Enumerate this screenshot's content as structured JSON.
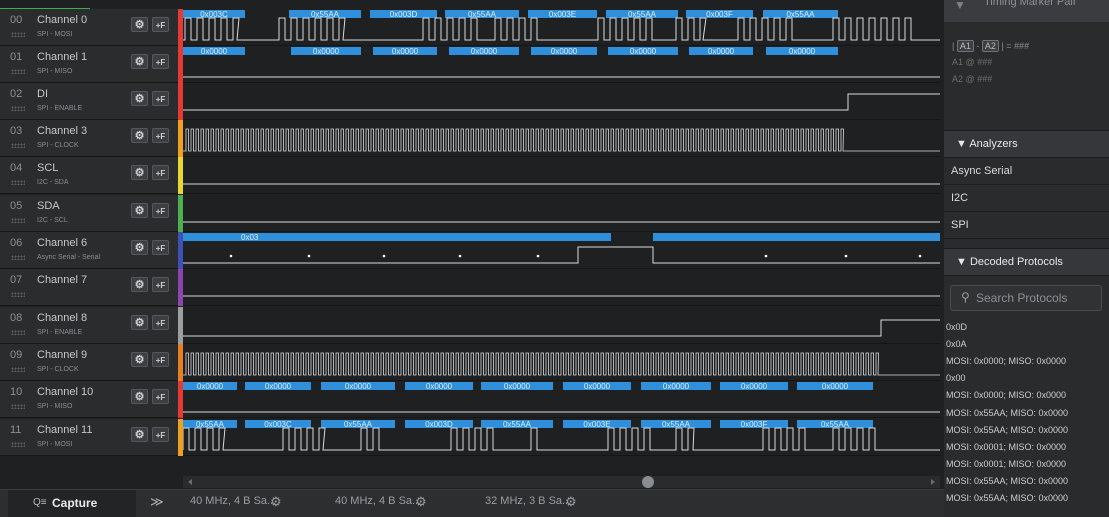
{
  "channels": [
    {
      "num": "00",
      "name": "Channel 0",
      "sub": "SPI - MOSI",
      "color": "#e53935"
    },
    {
      "num": "01",
      "name": "Channel 1",
      "sub": "SPI - MISO",
      "color": "#e53935"
    },
    {
      "num": "02",
      "name": "DI",
      "sub": "SPI - ENABLE",
      "color": "#e53935"
    },
    {
      "num": "03",
      "name": "Channel 3",
      "sub": "SPI - CLOCK",
      "color": "#f0a020"
    },
    {
      "num": "04",
      "name": "SCL",
      "sub": "I2C - SDA",
      "color": "#e8d730"
    },
    {
      "num": "05",
      "name": "SDA",
      "sub": "I2C - SCL",
      "color": "#4caf50"
    },
    {
      "num": "06",
      "name": "Channel 6",
      "sub": "Async Serial - Serial",
      "color": "#3f51b5"
    },
    {
      "num": "07",
      "name": "Channel 7",
      "sub": "",
      "color": "#8e44ad"
    },
    {
      "num": "08",
      "name": "Channel 8",
      "sub": "SPI - ENABLE",
      "color": "#9e9e9e"
    },
    {
      "num": "09",
      "name": "Channel 9",
      "sub": "SPI - CLOCK",
      "color": "#e67e22"
    },
    {
      "num": "10",
      "name": "Channel 10",
      "sub": "SPI - MISO",
      "color": "#e53935"
    },
    {
      "num": "11",
      "name": "Channel 11",
      "sub": "SPI - MOSI",
      "color": "#f0a020"
    }
  ],
  "gear_glyph": "⚙",
  "trigger_glyph": "+F",
  "decode_rows": {
    "ch0": [
      "0x003C",
      "0x55AA",
      "0x003D",
      "0x55AA",
      "0x003E",
      "0x55AA",
      "0x003F",
      "0x55AA"
    ],
    "ch1": [
      "0x0000",
      "0x0000",
      "0x0000",
      "0x0000",
      "0x0000",
      "0x0000",
      "0x0000",
      "0x0000"
    ],
    "ch6": [
      "0x03"
    ],
    "ch10": [
      "0x0000",
      "0x0000",
      "0x0000",
      "0x0000",
      "0x0000",
      "0x0000",
      "0x0000",
      "0x0000",
      "0x0000"
    ],
    "ch11": [
      "0x55AA",
      "0x003C",
      "0x55AA",
      "0x003D",
      "0x55AA",
      "0x003E",
      "0x55AA",
      "0x003F",
      "0x55AA"
    ]
  },
  "timing": {
    "title": "Timing Marker Pair",
    "formula_a1": "A1",
    "formula_a2": "A2",
    "formula_result": "= ###",
    "a1_label": "A1",
    "a1_at": "@",
    "a1_value": "###",
    "a2_label": "A2",
    "a2_at": "@",
    "a2_value": "###"
  },
  "analyzers": {
    "header": "▼ Analyzers",
    "items": [
      "Async Serial",
      "I2C",
      "SPI"
    ]
  },
  "decoded": {
    "header": "▼ Decoded Protocols",
    "search_placeholder": "Search Protocols",
    "search_icon": "⚲",
    "items": [
      "0x0D",
      "0x0A",
      "MOSI: 0x0000;  MISO: 0x0000",
      "0x00",
      "MOSI: 0x0000;  MISO: 0x0000",
      "MOSI: 0x55AA;  MISO: 0x0000",
      "MOSI: 0x55AA;  MISO: 0x0000",
      "MOSI: 0x0001;  MISO: 0x0000",
      "MOSI: 0x0001;  MISO: 0x0000",
      "MOSI: 0x55AA;  MISO: 0x0000",
      "MOSI: 0x55AA;  MISO: 0x0000"
    ]
  },
  "tabs": {
    "capture_icon": "Q≡",
    "capture_label": "Capture",
    "more_glyph": "≫",
    "sessions": [
      "40 MHz, 4 B Sa...",
      "40 MHz, 4 B Sa...",
      "32 MHz, 3 B Sa..."
    ]
  }
}
